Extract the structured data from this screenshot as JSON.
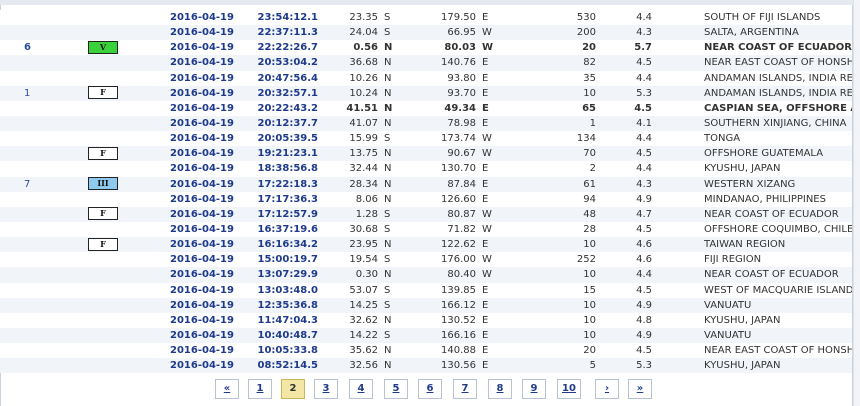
{
  "rows": [
    {
      "num": "",
      "badge": "",
      "badge_style": "",
      "date": "2016-04-19",
      "time": "23:54:12.1",
      "lat": "23.35",
      "ns": "S",
      "lon": "179.50",
      "ew": "E",
      "depth": "530",
      "mag": "4.4",
      "region": "SOUTH OF FIJI ISLANDS",
      "bold": false
    },
    {
      "num": "",
      "badge": "",
      "badge_style": "",
      "date": "2016-04-19",
      "time": "22:37:11.3",
      "lat": "24.04",
      "ns": "S",
      "lon": "66.95",
      "ew": "W",
      "depth": "200",
      "mag": "4.3",
      "region": "SALTA, ARGENTINA",
      "bold": false
    },
    {
      "num": "6",
      "badge": "V",
      "badge_style": "green",
      "date": "2016-04-19",
      "time": "22:22:26.7",
      "lat": "0.56",
      "ns": "N",
      "lon": "80.03",
      "ew": "W",
      "depth": "20",
      "mag": "5.7",
      "region": "NEAR COAST OF ECUADOR",
      "bold": true
    },
    {
      "num": "",
      "badge": "",
      "badge_style": "",
      "date": "2016-04-19",
      "time": "20:53:04.2",
      "lat": "36.68",
      "ns": "N",
      "lon": "140.76",
      "ew": "E",
      "depth": "82",
      "mag": "4.5",
      "region": "NEAR EAST COAST OF HONSHU, JAPAN",
      "bold": false
    },
    {
      "num": "",
      "badge": "",
      "badge_style": "",
      "date": "2016-04-19",
      "time": "20:47:56.4",
      "lat": "10.26",
      "ns": "N",
      "lon": "93.80",
      "ew": "E",
      "depth": "35",
      "mag": "4.4",
      "region": "ANDAMAN ISLANDS, INDIA REGION",
      "bold": false
    },
    {
      "num": "1",
      "badge": "F",
      "badge_style": "white",
      "date": "2016-04-19",
      "time": "20:32:57.1",
      "lat": "10.24",
      "ns": "N",
      "lon": "93.70",
      "ew": "E",
      "depth": "10",
      "mag": "5.3",
      "region": "ANDAMAN ISLANDS, INDIA REGION",
      "bold": false
    },
    {
      "num": "",
      "badge": "",
      "badge_style": "",
      "date": "2016-04-19",
      "time": "20:22:43.2",
      "lat": "41.51",
      "ns": "N",
      "lon": "49.34",
      "ew": "E",
      "depth": "65",
      "mag": "4.5",
      "region": "CASPIAN SEA, OFFSHORE AZERBAIJAN",
      "bold": true
    },
    {
      "num": "",
      "badge": "",
      "badge_style": "",
      "date": "2016-04-19",
      "time": "20:12:37.7",
      "lat": "41.07",
      "ns": "N",
      "lon": "78.98",
      "ew": "E",
      "depth": "1",
      "mag": "4.1",
      "region": "SOUTHERN XINJIANG, CHINA",
      "bold": false
    },
    {
      "num": "",
      "badge": "",
      "badge_style": "",
      "date": "2016-04-19",
      "time": "20:05:39.5",
      "lat": "15.99",
      "ns": "S",
      "lon": "173.74",
      "ew": "W",
      "depth": "134",
      "mag": "4.4",
      "region": "TONGA",
      "bold": false
    },
    {
      "num": "",
      "badge": "F",
      "badge_style": "white",
      "date": "2016-04-19",
      "time": "19:21:23.1",
      "lat": "13.75",
      "ns": "N",
      "lon": "90.67",
      "ew": "W",
      "depth": "70",
      "mag": "4.5",
      "region": "OFFSHORE GUATEMALA",
      "bold": false
    },
    {
      "num": "",
      "badge": "",
      "badge_style": "",
      "date": "2016-04-19",
      "time": "18:38:56.8",
      "lat": "32.44",
      "ns": "N",
      "lon": "130.70",
      "ew": "E",
      "depth": "2",
      "mag": "4.4",
      "region": "KYUSHU, JAPAN",
      "bold": false
    },
    {
      "num": "7",
      "badge": "III",
      "badge_style": "blue",
      "date": "2016-04-19",
      "time": "17:22:18.3",
      "lat": "28.34",
      "ns": "N",
      "lon": "87.84",
      "ew": "E",
      "depth": "61",
      "mag": "4.3",
      "region": "WESTERN XIZANG",
      "bold": false
    },
    {
      "num": "",
      "badge": "",
      "badge_style": "",
      "date": "2016-04-19",
      "time": "17:17:36.3",
      "lat": "8.06",
      "ns": "N",
      "lon": "126.60",
      "ew": "E",
      "depth": "94",
      "mag": "4.9",
      "region": "MINDANAO, PHILIPPINES",
      "bold": false
    },
    {
      "num": "",
      "badge": "F",
      "badge_style": "white",
      "date": "2016-04-19",
      "time": "17:12:57.9",
      "lat": "1.28",
      "ns": "S",
      "lon": "80.87",
      "ew": "W",
      "depth": "48",
      "mag": "4.7",
      "region": "NEAR COAST OF ECUADOR",
      "bold": false
    },
    {
      "num": "",
      "badge": "",
      "badge_style": "",
      "date": "2016-04-19",
      "time": "16:37:19.6",
      "lat": "30.68",
      "ns": "S",
      "lon": "71.82",
      "ew": "W",
      "depth": "28",
      "mag": "4.5",
      "region": "OFFSHORE COQUIMBO, CHILE",
      "bold": false
    },
    {
      "num": "",
      "badge": "F",
      "badge_style": "white",
      "date": "2016-04-19",
      "time": "16:16:34.2",
      "lat": "23.95",
      "ns": "N",
      "lon": "122.62",
      "ew": "E",
      "depth": "10",
      "mag": "4.6",
      "region": "TAIWAN REGION",
      "bold": false
    },
    {
      "num": "",
      "badge": "",
      "badge_style": "",
      "date": "2016-04-19",
      "time": "15:00:19.7",
      "lat": "19.54",
      "ns": "S",
      "lon": "176.00",
      "ew": "W",
      "depth": "252",
      "mag": "4.6",
      "region": "FIJI REGION",
      "bold": false
    },
    {
      "num": "",
      "badge": "",
      "badge_style": "",
      "date": "2016-04-19",
      "time": "13:07:29.9",
      "lat": "0.30",
      "ns": "N",
      "lon": "80.40",
      "ew": "W",
      "depth": "10",
      "mag": "4.4",
      "region": "NEAR COAST OF ECUADOR",
      "bold": false
    },
    {
      "num": "",
      "badge": "",
      "badge_style": "",
      "date": "2016-04-19",
      "time": "13:03:48.0",
      "lat": "53.07",
      "ns": "S",
      "lon": "139.85",
      "ew": "E",
      "depth": "15",
      "mag": "4.5",
      "region": "WEST OF MACQUARIE ISLAND",
      "bold": false
    },
    {
      "num": "",
      "badge": "",
      "badge_style": "",
      "date": "2016-04-19",
      "time": "12:35:36.8",
      "lat": "14.25",
      "ns": "S",
      "lon": "166.12",
      "ew": "E",
      "depth": "10",
      "mag": "4.9",
      "region": "VANUATU",
      "bold": false
    },
    {
      "num": "",
      "badge": "",
      "badge_style": "",
      "date": "2016-04-19",
      "time": "11:47:04.3",
      "lat": "32.62",
      "ns": "N",
      "lon": "130.52",
      "ew": "E",
      "depth": "10",
      "mag": "4.8",
      "region": "KYUSHU, JAPAN",
      "bold": false
    },
    {
      "num": "",
      "badge": "",
      "badge_style": "",
      "date": "2016-04-19",
      "time": "10:40:48.7",
      "lat": "14.22",
      "ns": "S",
      "lon": "166.16",
      "ew": "E",
      "depth": "10",
      "mag": "4.9",
      "region": "VANUATU",
      "bold": false
    },
    {
      "num": "",
      "badge": "",
      "badge_style": "",
      "date": "2016-04-19",
      "time": "10:05:33.8",
      "lat": "35.62",
      "ns": "N",
      "lon": "140.88",
      "ew": "E",
      "depth": "20",
      "mag": "4.5",
      "region": "NEAR EAST COAST OF HONSHU, JAPAN",
      "bold": false
    },
    {
      "num": "",
      "badge": "",
      "badge_style": "",
      "date": "2016-04-19",
      "time": "08:52:14.5",
      "lat": "32.56",
      "ns": "N",
      "lon": "130.56",
      "ew": "E",
      "depth": "5",
      "mag": "5.3",
      "region": "KYUSHU, JAPAN",
      "bold": false
    }
  ],
  "pagination": {
    "current": "2",
    "items": [
      "«",
      "1",
      "2",
      "3",
      "4",
      "5",
      "6",
      "7",
      "8",
      "9",
      "10",
      "›",
      "»"
    ]
  },
  "colors": {
    "badge_green": "#3ad23a",
    "badge_blue": "#8ec9ee",
    "link_blue": "#1f3a8a",
    "current_page": "#f4e7a6"
  }
}
